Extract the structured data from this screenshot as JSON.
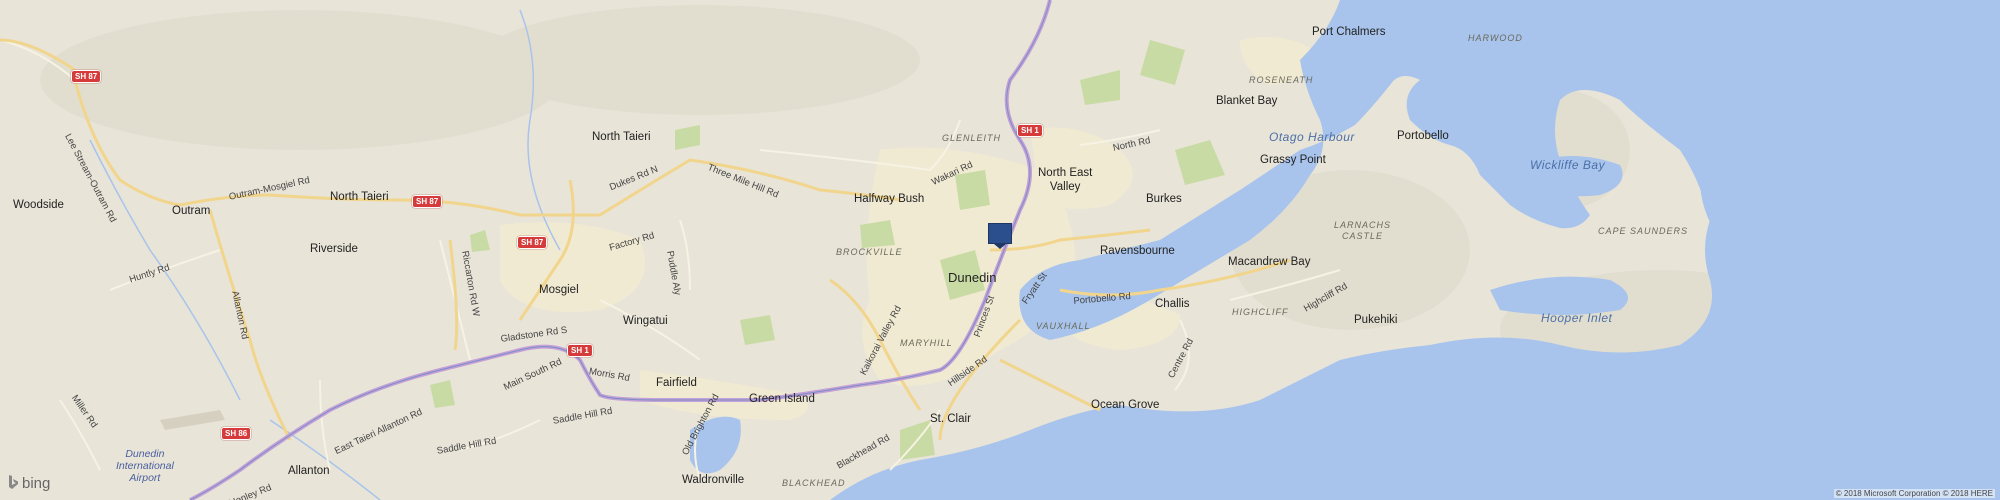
{
  "map": {
    "towns": {
      "port_chalmers": "Port Chalmers",
      "blanket_bay": "Blanket Bay",
      "portobello": "Portobello",
      "grassy_point": "Grassy Point",
      "north_taieri_top": "North Taieri",
      "north_taieri_mid": "North Taieri",
      "halfway_bush": "Halfway Bush",
      "north_east_valley": "North East\nValley",
      "burkes": "Burkes",
      "woodside": "Woodside",
      "outram": "Outram",
      "riverside": "Riverside",
      "ravensbourne": "Ravensbourne",
      "dunedin": "Dunedin",
      "macandrew_bay": "Macandrew Bay",
      "mosgiel": "Mosgiel",
      "challis": "Challis",
      "wingatui": "Wingatui",
      "pukehiki": "Pukehiki",
      "fairfield": "Fairfield",
      "green_island": "Green Island",
      "ocean_grove": "Ocean Grove",
      "st_clair": "St. Clair",
      "allanton": "Allanton",
      "waldronville": "Waldronville"
    },
    "localities": {
      "harwood": "HARWOOD",
      "roseneath": "ROSENEATH",
      "glenleith": "GLENLEITH",
      "larnachs_castle": "LARNACHS\nCASTLE",
      "cape_saunders": "CAPE SAUNDERS",
      "brockville": "BROCKVILLE",
      "highcliff": "HIGHCLIFF",
      "vauxhall": "VAUXHALL",
      "maryhill": "MARYHILL",
      "blackhead": "BLACKHEAD"
    },
    "water": {
      "otago_harbour": "Otago Harbour",
      "wickliffe_bay": "Wickliffe Bay",
      "hooper_inlet": "Hooper Inlet"
    },
    "roads": {
      "lee_stream_outram": "Lee Stream-Outram Rd",
      "outram_mosgiel": "Outram-Mosgiel Rd",
      "dukes_rd_n": "Dukes Rd N",
      "three_mile_hill": "Three Mile Hill Rd",
      "wakari": "Wakari Rd",
      "north_rd": "North Rd",
      "huntly": "Huntly Rd",
      "factory": "Factory Rd",
      "puddle_aly": "Puddle Aly",
      "riccarton": "Riccarton Rd W",
      "allanton": "Allanton Rd",
      "gladstone": "Gladstone Rd S",
      "main_south": "Main South Rd",
      "kaikorai": "Kaikorai Valley Rd",
      "princes": "Princes St",
      "fryatt": "Fryatt St",
      "portobello_rd": "Portobello Rd",
      "highcliff_rd": "Highcliff Rd",
      "centre": "Centre Rd",
      "hillside": "Hillside Rd",
      "morris": "Morris Rd",
      "saddle_hill": "Saddle Hill Rd",
      "miller": "Miller Rd",
      "east_taieri_allanton": "East Taieri Allanton Rd",
      "old_brighton": "Old Brighton Rd",
      "blackhead_rd": "Blackhead Rd",
      "henley": "Henley Rd"
    },
    "shields": {
      "sh87_a": "SH 87",
      "sh87_b": "SH 87",
      "sh87_c": "SH 87",
      "sh1_north": "SH 1",
      "sh1_mid": "SH 1",
      "sh86": "SH 86"
    },
    "airport": "Dunedin\nInternational\nAirport",
    "attribution": {
      "brand": "bing",
      "copyright": "© 2018 Microsoft Corporation © 2018 HERE"
    },
    "colors": {
      "land": "#e8e4d8",
      "water": "#a8c4ec",
      "urban": "#f1ead2",
      "park": "#c9dba4",
      "highway": "#c3a0d8",
      "major_road": "#f2d58c",
      "marker": "#2b4f8c"
    },
    "marker_icon": "location-pin-icon"
  }
}
